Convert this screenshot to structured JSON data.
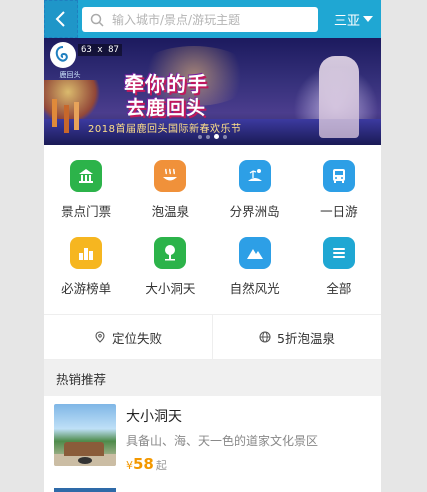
{
  "header": {
    "search_placeholder": "输入城市/景点/游玩主题",
    "city": "三亚"
  },
  "banner": {
    "dimension_badge": "63 x 87",
    "logo_text": "鹿回头",
    "slogan_line1": "牵你的手",
    "slogan_line2": "去鹿回头",
    "subline": "2018首届鹿回头国际新春欢乐节",
    "active_slide": 3,
    "slide_count": 4
  },
  "categories": [
    {
      "label": "景点门票",
      "icon": "ticket-icon",
      "color": "#2cb34a"
    },
    {
      "label": "泡温泉",
      "icon": "hot-spring-icon",
      "color": "#f0913a"
    },
    {
      "label": "分界洲岛",
      "icon": "island-icon",
      "color": "#2d9fe6"
    },
    {
      "label": "一日游",
      "icon": "bus-icon",
      "color": "#2d9fe6"
    },
    {
      "label": "必游榜单",
      "icon": "ranking-icon",
      "color": "#f6b620"
    },
    {
      "label": "大小洞天",
      "icon": "tree-icon",
      "color": "#2cb34a"
    },
    {
      "label": "自然风光",
      "icon": "mountain-icon",
      "color": "#2d9fe6"
    },
    {
      "label": "全部",
      "icon": "menu-icon",
      "color": "#1fa7d3"
    }
  ],
  "locbar": {
    "location": "定位失败",
    "promo": "5折泡温泉"
  },
  "section": {
    "title": "热销推荐"
  },
  "products": [
    {
      "name": "大小洞天",
      "desc": "具备山、海、天一色的道家文化景区",
      "currency": "¥",
      "price": "58",
      "price_suffix": "起"
    }
  ]
}
